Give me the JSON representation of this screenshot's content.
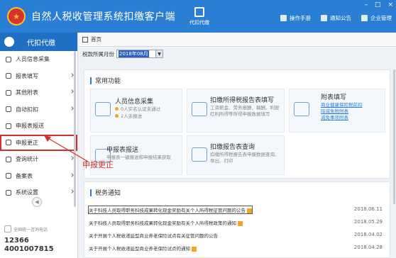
{
  "app": {
    "title": "自然人税收管理系统扣缴客户端",
    "mode_label": "代扣代缴"
  },
  "header_links": [
    {
      "icon": "manual-icon",
      "label": "操作手册"
    },
    {
      "icon": "notice-icon",
      "label": "通知公告"
    },
    {
      "icon": "company-icon",
      "label": "企业管理"
    }
  ],
  "window_controls": [
    "–",
    "□",
    "×"
  ],
  "sidebar": {
    "title": "代扣代缴",
    "items": [
      {
        "label": "人员信息采集",
        "icon": "person-icon",
        "chevron": false
      },
      {
        "label": "报表填写",
        "icon": "edit-icon",
        "chevron": true
      },
      {
        "label": "其他附表",
        "icon": "grid-icon",
        "chevron": true
      },
      {
        "label": "自动扣扣",
        "icon": "auto-icon",
        "chevron": true
      },
      {
        "label": "申报表报送",
        "icon": "send-icon",
        "chevron": false
      },
      {
        "label": "申报更正",
        "icon": "search-icon",
        "chevron": false,
        "active": true
      },
      {
        "label": "查询统计",
        "icon": "stats-icon",
        "chevron": true
      },
      {
        "label": "备案表",
        "icon": "file-icon",
        "chevron": true
      },
      {
        "label": "系统设置",
        "icon": "gear-icon",
        "chevron": true
      }
    ],
    "hotline_label": "全国统一咨询电话",
    "phone1": "12366",
    "phone2": "4001007815"
  },
  "tab": {
    "label": "首页"
  },
  "period": {
    "label": "税款所属月份",
    "value": "2018年08月"
  },
  "common": {
    "title": "常用功能",
    "cards": [
      {
        "title": "人员信息采集",
        "lines": [
          "0人实名认证未通过",
          "2人未报送"
        ]
      },
      {
        "title": "扣缴所得税报告表填写",
        "lines": [
          "工资薪金、劳务报酬、稿酬、利股",
          "红利所得等所得申报数据填写"
        ]
      },
      {
        "title": "附表填写",
        "links": [
          "商业健康保险税前扣",
          "除减免税附表",
          "减免事项附表"
        ]
      },
      {
        "title": "申报表报送",
        "lines": [
          "申报表一键报送和申报结果获取"
        ]
      },
      {
        "title": "扣缴报告表查询",
        "lines": [
          "扣缴所得税报告表申报数据查询、",
          "导出、打印"
        ]
      }
    ]
  },
  "notices": {
    "title": "税务通知",
    "items": [
      {
        "text": "关于科技人员取得职务科技成果转化现金奖励有关个人所得税征管问题的公告",
        "date": "2018.06.11",
        "new": true
      },
      {
        "text": "关于科技人员取得职务科技成果转化现金奖励有关个人所得税政策的通知",
        "date": "2018.05.29",
        "new": true
      },
      {
        "text": "关于开展个人税收递延型商业养老保险试点有关征管问题的公告",
        "date": "2018.04.02",
        "new": false
      },
      {
        "text": "关于开展个人税收递延型商业养老保险试点的通知",
        "date": "2018.04.28",
        "new": true
      }
    ]
  },
  "annotation": {
    "text": "申报更正"
  },
  "colors": {
    "brand": "#2a7fd4",
    "sidebar_head": "#1f6fc5",
    "annotation": "#d32f2f"
  }
}
